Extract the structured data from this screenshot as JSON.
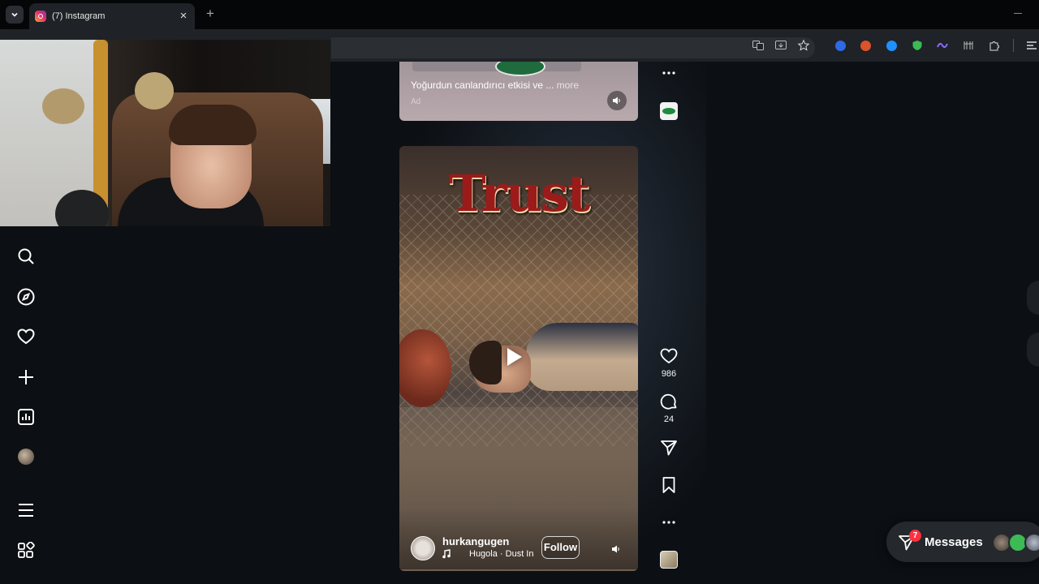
{
  "browser": {
    "tab_title": "(7) Instagram",
    "tab_close": "×",
    "new_tab": "+"
  },
  "prev_reel": {
    "caption": "Yoğurdun canlandırıcı etkisi ve ...",
    "more": "more",
    "meta": "Ad"
  },
  "reel": {
    "title_text": "Trust",
    "username": "hurkangugen",
    "song": "Hugola · Dust In",
    "follow_label": "Follow"
  },
  "actions": {
    "likes": "986",
    "comments": "24"
  },
  "messages": {
    "label": "Messages",
    "badge": "7"
  },
  "colors": {
    "page_bg": "#0c0f13",
    "badge_red": "#ff3040",
    "brand": "#e1306c"
  }
}
